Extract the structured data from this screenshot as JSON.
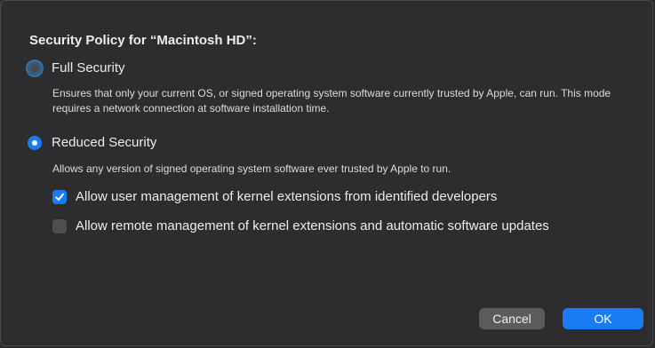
{
  "dialog": {
    "title": "Security Policy for “Macintosh HD”:"
  },
  "options": {
    "full": {
      "label": "Full Security",
      "selected": false,
      "description": "Ensures that only your current OS, or signed operating system software currently trusted by Apple, can run. This mode requires a network connection at software installation time."
    },
    "reduced": {
      "label": "Reduced Security",
      "selected": true,
      "description": "Allows any version of signed operating system software ever trusted by Apple to run."
    }
  },
  "checkboxes": {
    "kernel_ext": {
      "label": "Allow user management of kernel extensions from identified developers",
      "checked": true
    },
    "remote_mgmt": {
      "label": "Allow remote management of kernel extensions and automatic software updates",
      "checked": false
    }
  },
  "buttons": {
    "cancel": "Cancel",
    "ok": "OK"
  },
  "colors": {
    "accent": "#1a7cf5",
    "background": "#2d2d2f"
  },
  "icons": {
    "checkmark": "checkmark-icon"
  }
}
